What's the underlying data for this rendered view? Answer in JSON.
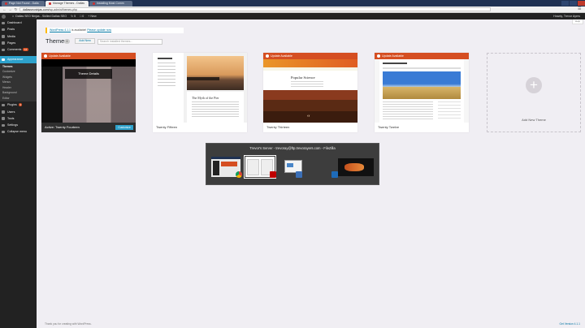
{
  "browser": {
    "tabs": [
      {
        "label": "Page Not Found - Dalla",
        "active": false
      },
      {
        "label": "Manage Themes - Dallas",
        "active": true
      },
      {
        "label": "Installing Most Comm",
        "active": false
      }
    ],
    "url_host": "dallasseoninjas.com",
    "url_path": "/wp-admin/themes.php"
  },
  "adminbar": {
    "site_name": "Dallas SEO Ninjas - Skilled Dallas SEO",
    "updates_count": "5",
    "comments_count": "0",
    "new_label": "New",
    "howdy": "Howdy, Trevor Ayers"
  },
  "sidebar": {
    "items_top": [
      {
        "label": "Dashboard"
      },
      {
        "label": "Posts"
      },
      {
        "label": "Media"
      },
      {
        "label": "Pages"
      },
      {
        "label": "Comments",
        "badge": "12"
      }
    ],
    "current": "Appearance",
    "subitems": [
      "Themes",
      "Customize",
      "Widgets",
      "Menus",
      "Header",
      "Background",
      "Editor"
    ],
    "items_bottom": [
      {
        "label": "Plugins",
        "badge": "3"
      },
      {
        "label": "Users"
      },
      {
        "label": "Tools"
      },
      {
        "label": "Settings"
      },
      {
        "label": "Collapse menu"
      }
    ]
  },
  "main": {
    "help_label": "Help",
    "notice_link": "WordPress 4.1.1",
    "notice_text": " is available! ",
    "notice_update": "Please update now",
    "title": "Themes",
    "count": "4",
    "add_new": "Add New",
    "search_placeholder": "Search installed themes..."
  },
  "themes": [
    {
      "name": "Active: Twenty Fourteen",
      "update": "Update Available",
      "details": "Theme Details",
      "customize": "Customize"
    },
    {
      "name": "Twenty Fifteen",
      "post_title": "The Myth of the Pier"
    },
    {
      "name": "Twenty Thirteen",
      "update": "Update Available",
      "post_title": "Popular Science",
      "quote": "“"
    },
    {
      "name": "Twenty Twelve",
      "update": "Update Available"
    }
  ],
  "add_theme_label": "Add New Theme",
  "switcher": {
    "title": "Trevor's Server - trevoray@ftp.trevorayers.com - FileZilla"
  },
  "footer": {
    "left": "Thank you for creating with WordPress.",
    "right": "Get Version 4.1.1"
  },
  "colors": {
    "accent": "#2ea2cc",
    "update": "#d54e21",
    "adminbar": "#222222",
    "background": "#f0eef3"
  }
}
